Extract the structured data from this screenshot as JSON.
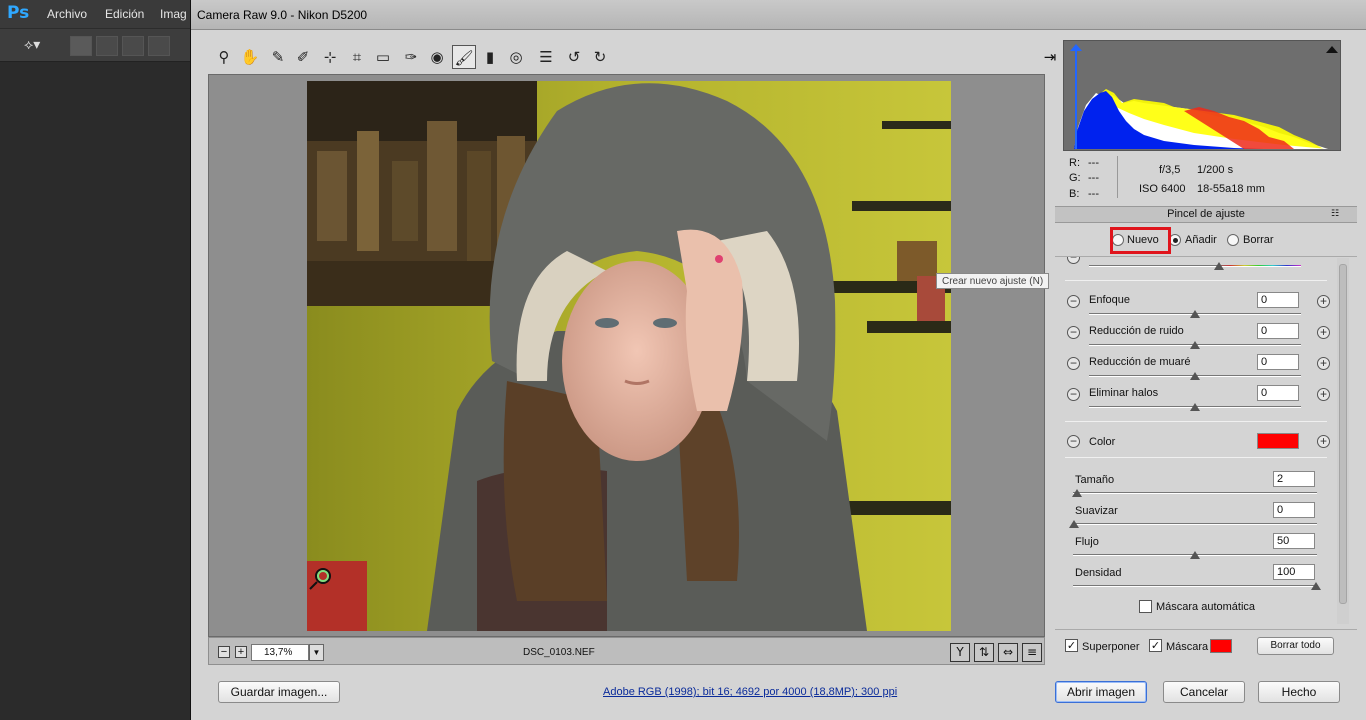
{
  "ps": {
    "logo": "Ps",
    "menu": [
      "Archivo",
      "Edición",
      "Imag"
    ]
  },
  "dialog": {
    "title": "Camera Raw 9.0 -  Nikon D5200",
    "tools": [
      "zoom-icon",
      "hand-icon",
      "white-balance-icon",
      "color-sampler-icon",
      "targeted-adjustment-icon",
      "crop-icon",
      "straighten-icon",
      "spot-removal-icon",
      "red-eye-icon",
      "adjustment-brush-icon",
      "graduated-filter-icon",
      "radial-filter-icon",
      "presets-list-icon",
      "rotate-left-icon",
      "rotate-right-icon"
    ],
    "exit_icon": "fullscreen-exit-icon"
  },
  "status": {
    "zoom": "13,7%",
    "filename": "DSC_0103.NEF"
  },
  "footer": {
    "save_label": "Guardar imagen...",
    "workflow_link": "Adobe RGB (1998); bit 16; 4692 por 4000 (18,8MP); 300 ppi",
    "open_label": "Abrir imagen",
    "cancel_label": "Cancelar",
    "done_label": "Hecho"
  },
  "info": {
    "r_label": "R:",
    "r_val": "---",
    "g_label": "G:",
    "g_val": "---",
    "b_label": "B:",
    "b_val": "---",
    "aperture": "f/3,5",
    "shutter": "1/200 s",
    "iso": "ISO 6400",
    "lens": "18-55a18 mm"
  },
  "panel": {
    "title": "Pincel de ajuste",
    "mode_new": "Nuevo",
    "mode_add": "Añadir",
    "mode_erase": "Borrar",
    "tooltip": "Crear nuevo ajuste (N)",
    "adjustments": [
      {
        "label": "Enfoque",
        "value": "0"
      },
      {
        "label": "Reducción de ruido",
        "value": "0"
      },
      {
        "label": "Reducción de muaré",
        "value": "0"
      },
      {
        "label": "Eliminar halos",
        "value": "0"
      }
    ],
    "color_label": "Color",
    "color_swatch": "#ff0000",
    "brush": [
      {
        "label": "Tamaño",
        "value": "2"
      },
      {
        "label": "Suavizar",
        "value": "0"
      },
      {
        "label": "Flujo",
        "value": "50"
      },
      {
        "label": "Densidad",
        "value": "100"
      }
    ],
    "auto_mask_label": "Máscara automática",
    "overlay_label": "Superponer",
    "mask_label": "Máscara",
    "mask_color": "#ff0000",
    "clear_all_label": "Borrar todo"
  }
}
